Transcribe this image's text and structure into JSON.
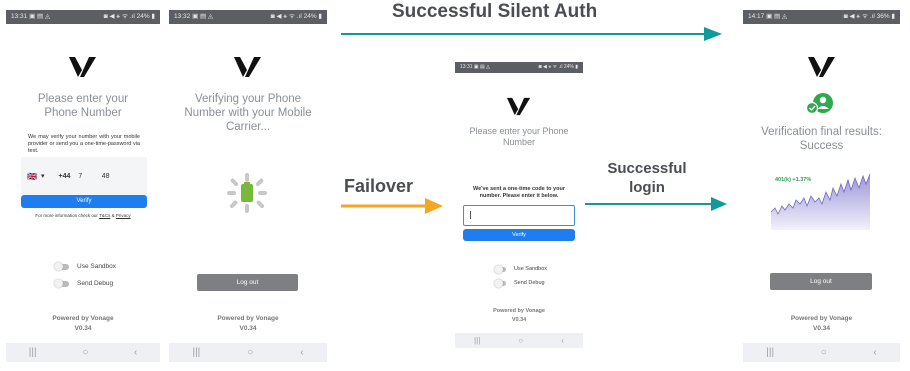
{
  "phone1": {
    "status_time": "13:31 ▣ ▤ ◬",
    "status_icons": "◙ ◀ ⚹ ᯤ .ıl 24% ▮",
    "title": "Please enter your Phone Number",
    "info_text": "We may verify your number with your mobile provider or send you a one-time-password via text.",
    "flag": "🇬🇧",
    "dropdown_arrow": "▾",
    "country_code": "+44",
    "phone_number": "7          48",
    "verify_label": "Verify",
    "terms_text_prefix": "For more information check our",
    "terms_link": "T&Cs",
    "terms_and": "&",
    "privacy_link": "Privacy",
    "sandbox_label": "Use Sandbox",
    "debug_label": "Send Debug",
    "powered": "Powered by Vonage",
    "version": "V0.34"
  },
  "phone2": {
    "status_time": "13:32 ▣ ▤ ◬",
    "status_icons": "◙ ◀ ⚹ ᯤ .ıl 24% ▮",
    "title": "Verifying your Phone Number with your Mobile Carrier...",
    "logout_label": "Log out",
    "powered": "Powered by Vonage",
    "version": "V0.34"
  },
  "phone3": {
    "status_time": "13:31 ▣ ▤ ◬",
    "status_icons": "◙ ◀ ⚹ ᯤ .ıl 24% ▮",
    "title": "Please enter your Phone Number",
    "otp_text": "We've sent a one-time code to your number. Please enter it below.",
    "verify_label": "Verify",
    "sandbox_label": "Use Sandbox",
    "debug_label": "Send Debug",
    "powered": "Powered by Vonage",
    "version": "V0.34"
  },
  "phone4": {
    "status_time": "14:17 ▣ ▤ ◬",
    "status_icons": "◙ ◀ ⚹ ᯤ .ıl 36% ▮",
    "title": "Verification final results: Success",
    "chart_label": "401(k) +1.37%",
    "logout_label": "Log out",
    "powered": "Powered by Vonage",
    "version": "V0.34"
  },
  "nav": {
    "recents": "|||",
    "home": "○",
    "back": "‹"
  },
  "flow": {
    "silent_auth_label": "Successful Silent Auth",
    "failover_label": "Failover",
    "login_label": "Successful login",
    "teal": "#0f9aa0",
    "orange": "#f5a623"
  }
}
